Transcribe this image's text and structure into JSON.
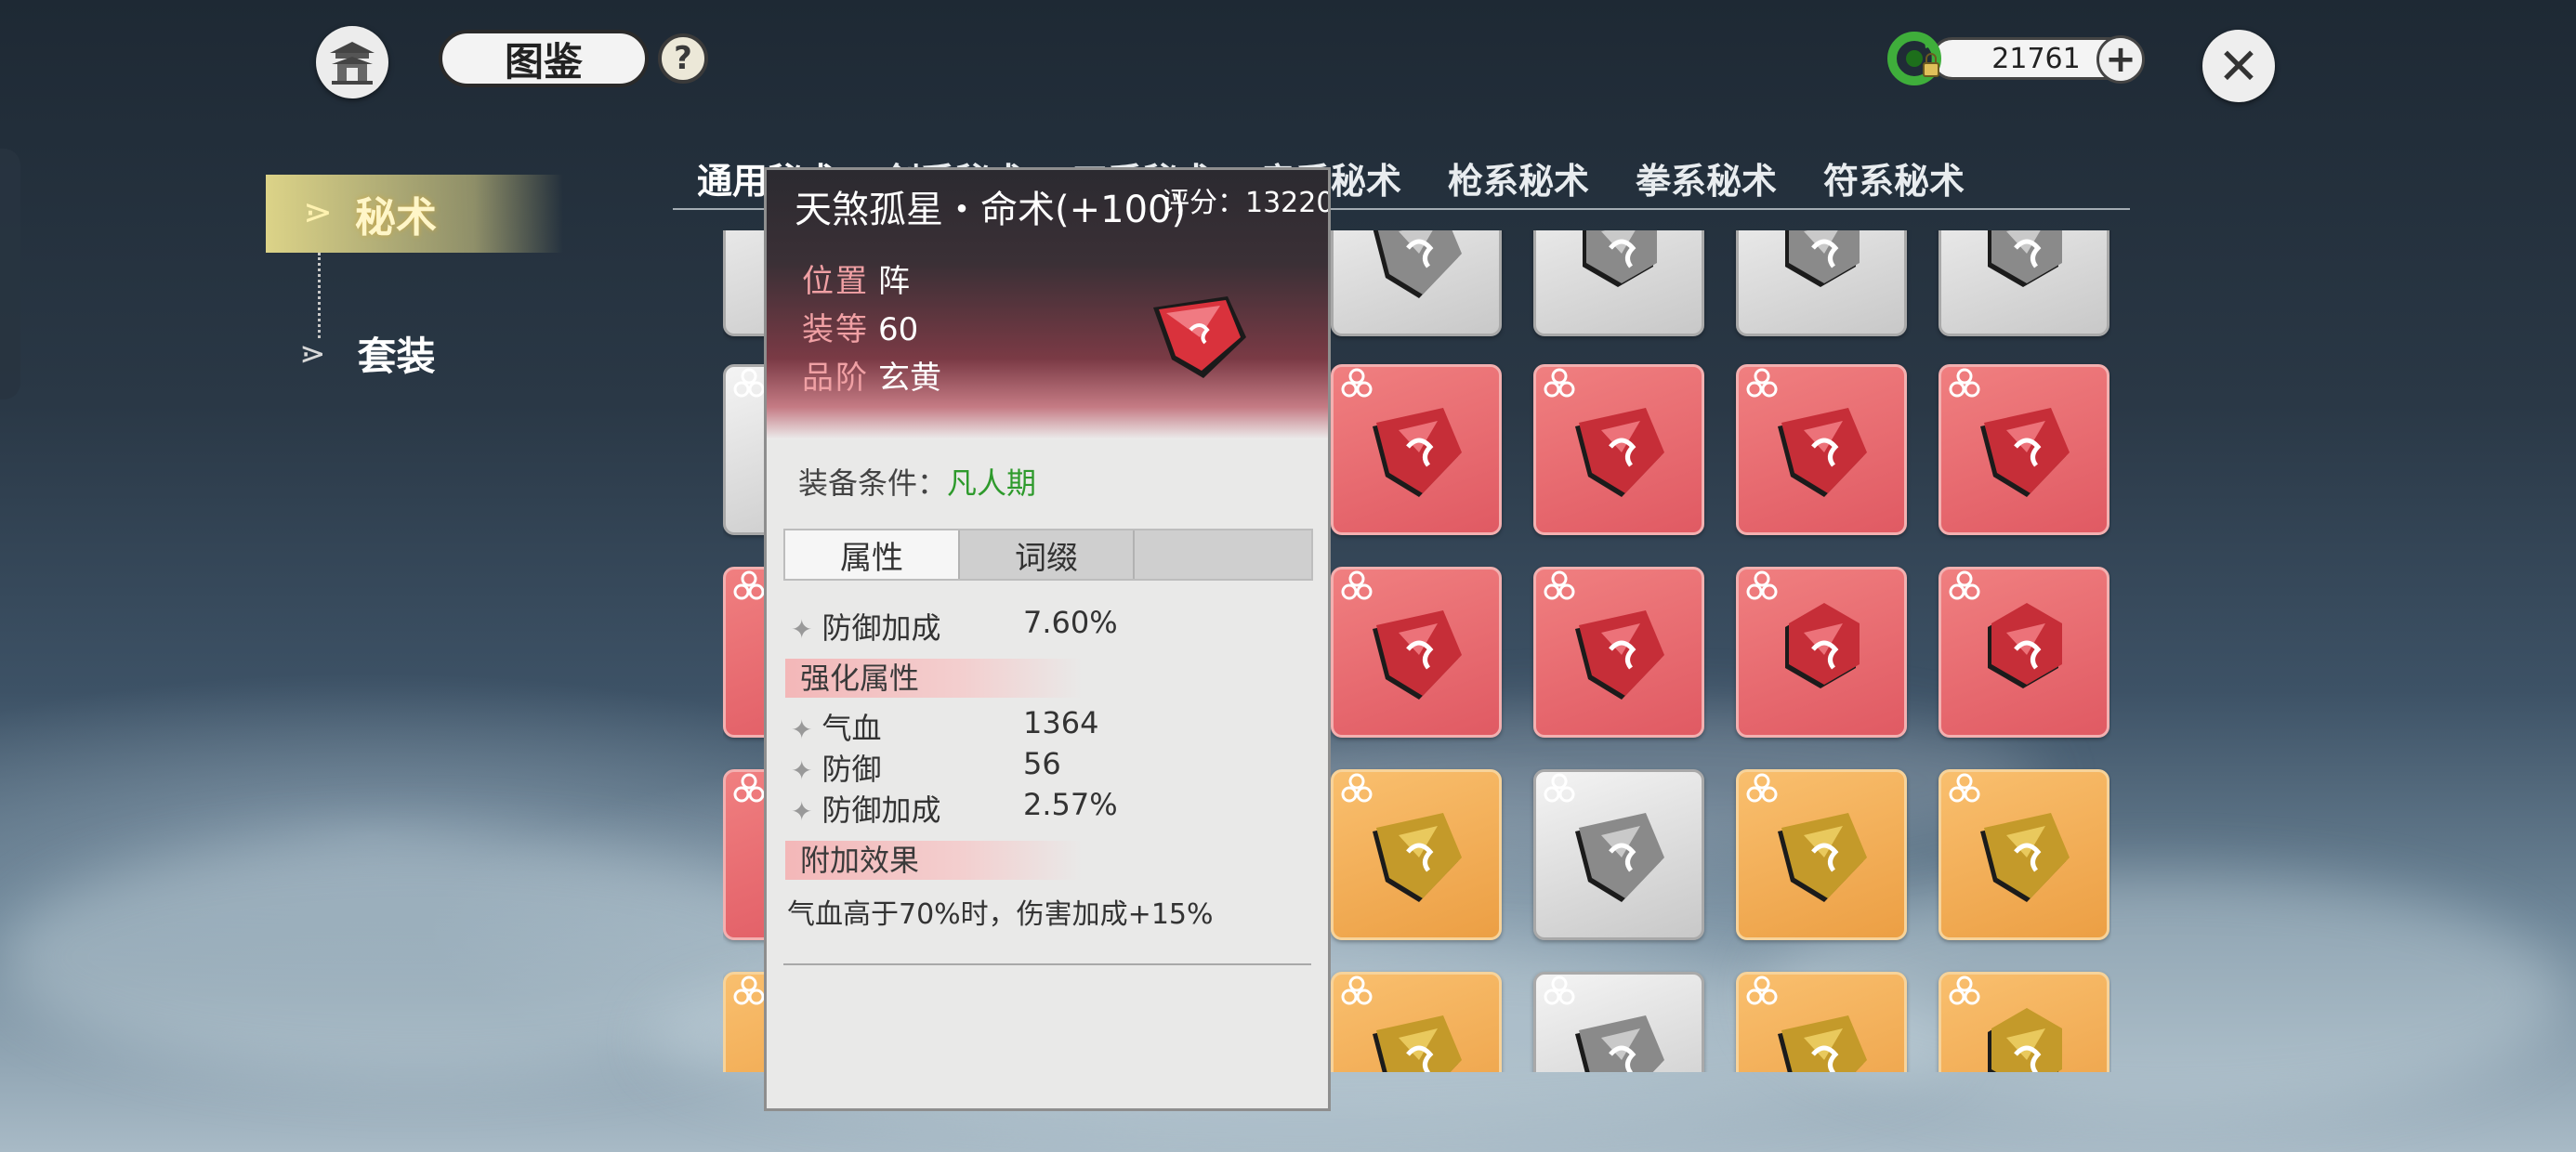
{
  "header": {
    "title": "图鉴",
    "help_label": "?",
    "currency_value": "21761",
    "plus_label": "+",
    "close_label": "✕"
  },
  "sidebar": {
    "items": [
      {
        "label": "秘术",
        "active": true
      },
      {
        "label": "套装",
        "active": false
      }
    ]
  },
  "tabs": [
    "通用秘术",
    "剑系秘术",
    "刀系秘术",
    "扇系秘术",
    "枪系秘术",
    "拳系秘术",
    "符系秘术"
  ],
  "tooltip": {
    "name": "天煞孤星・命术(+100)",
    "score": "评分：13220",
    "position_label": "位置",
    "position_value": "阵",
    "level_label": "装等",
    "level_value": "60",
    "rank_label": "品阶",
    "rank_value": "玄黄",
    "condition_label": "装备条件：",
    "condition_value": "凡人期",
    "tab_attr": "属性",
    "tab_affix": "词缀",
    "base_stat_name": "防御加成",
    "base_stat_value": "7.60%",
    "enhance_header": "强化属性",
    "enhance": [
      {
        "name": "气血",
        "value": "1364"
      },
      {
        "name": "防御",
        "value": "56"
      },
      {
        "name": "防御加成",
        "value": "2.57%"
      }
    ],
    "extra_header": "附加效果",
    "extra_text": "气血高于70%时，伤害加成+15%"
  },
  "colors": {
    "card_gray": "#d6d6d6",
    "card_red": "#e8676e",
    "card_orange": "#f2a954",
    "sidebar_active": "#e6dc8c",
    "condition_green": "#2e9a2c"
  }
}
